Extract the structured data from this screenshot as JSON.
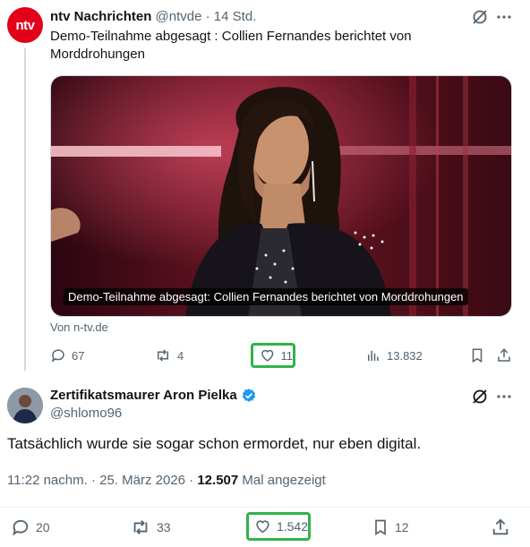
{
  "tweet1": {
    "avatar_text": "ntv",
    "author_name": "ntv Nachrichten",
    "handle": "@ntvde",
    "separator": "·",
    "time": "14 Std.",
    "text": "Demo-Teilnahme abgesagt : Collien Fernandes berichtet von Morddrohungen",
    "media_caption": "Demo-Teilnahme abgesagt: Collien Fernandes berichtet von Morddrohungen",
    "source": "Von n-tv.de",
    "actions": {
      "replies": "67",
      "reposts": "4",
      "likes": "11",
      "views": "13.832"
    }
  },
  "tweet2": {
    "author_name": "Zertifikatsmaurer Aron Pielka",
    "handle": "@shlomo96",
    "text": "Tatsächlich wurde sie sogar schon ermordet, nur eben digital.",
    "timestamp": "11:22 nachm. · 25. März 2026 ·",
    "views_count": "12.507",
    "views_label": "Mal angezeigt",
    "actions": {
      "replies": "20",
      "reposts": "33",
      "likes": "1.542",
      "bookmarks": "12"
    }
  },
  "colors": {
    "ntv_red": "#e2001a",
    "verified_blue": "#1d9bf0",
    "highlight_green": "#2fb34a",
    "muted_text": "#536471"
  },
  "icons": [
    "grok-icon",
    "more-icon",
    "reply-icon",
    "repost-icon",
    "like-icon",
    "views-icon",
    "bookmark-icon",
    "share-icon",
    "verified-badge-icon"
  ]
}
